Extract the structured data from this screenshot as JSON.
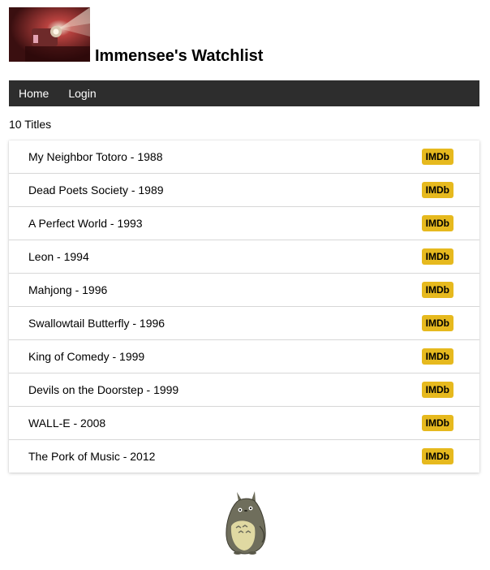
{
  "header": {
    "title": "Immensee's Watchlist",
    "logo_icon": "projector-logo-icon"
  },
  "nav": {
    "items": [
      {
        "label": "Home"
      },
      {
        "label": "Login"
      }
    ]
  },
  "count_text": "10 Titles",
  "movies": [
    {
      "title": "My Neighbor Totoro - 1988",
      "badge": "IMDb"
    },
    {
      "title": "Dead Poets Society - 1989",
      "badge": "IMDb"
    },
    {
      "title": "A Perfect World - 1993",
      "badge": "IMDb"
    },
    {
      "title": "Leon - 1994",
      "badge": "IMDb"
    },
    {
      "title": "Mahjong - 1996",
      "badge": "IMDb"
    },
    {
      "title": "Swallowtail Butterfly - 1996",
      "badge": "IMDb"
    },
    {
      "title": "King of Comedy - 1999",
      "badge": "IMDb"
    },
    {
      "title": "Devils on the Doorstep - 1999",
      "badge": "IMDb"
    },
    {
      "title": "WALL-E - 2008",
      "badge": "IMDb"
    },
    {
      "title": "The Pork of Music - 2012",
      "badge": "IMDb"
    }
  ],
  "footer": {
    "mascot_icon": "totoro-icon"
  },
  "colors": {
    "navbar": "#2d2d2d",
    "badge": "#e6b91e"
  }
}
